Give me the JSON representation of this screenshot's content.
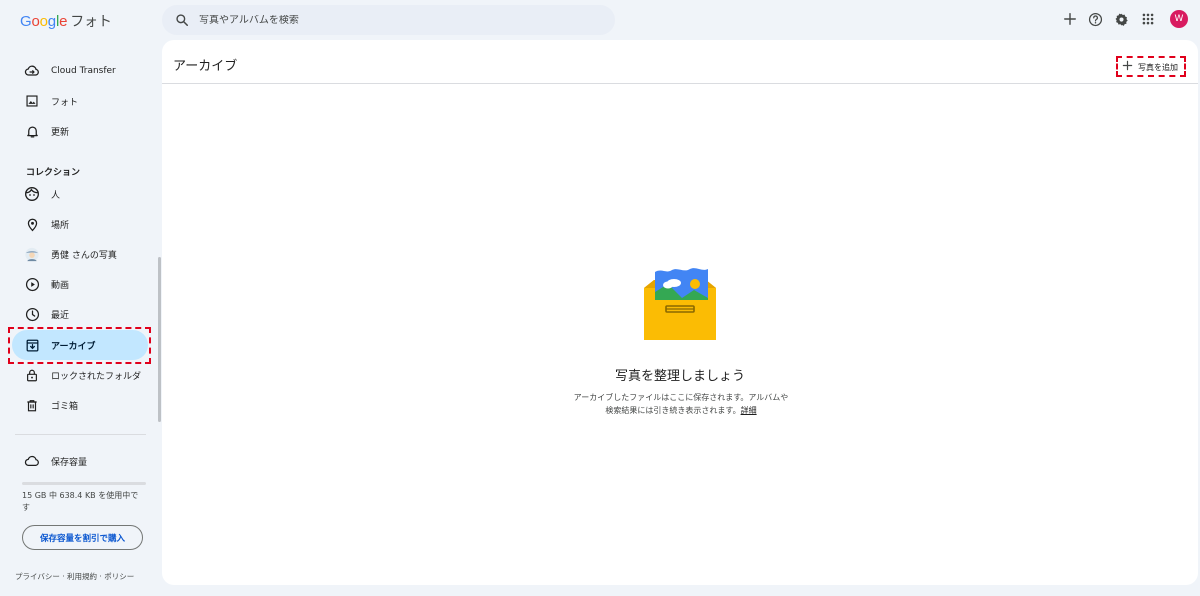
{
  "app": {
    "logo_word": "Google",
    "product": "フォト"
  },
  "search": {
    "placeholder": "写真やアルバムを検索"
  },
  "topbar": {
    "avatar_letter": "W",
    "icons": [
      "plus-icon",
      "help-icon",
      "settings-icon",
      "apps-icon"
    ]
  },
  "sidebar": {
    "items": [
      {
        "label": "Cloud Transfer",
        "icon": "cloud-transfer-icon"
      },
      {
        "label": "フォト",
        "icon": "photo-icon"
      },
      {
        "label": "更新",
        "icon": "bell-icon"
      }
    ],
    "collection_label": "コレクション",
    "collection_items": [
      {
        "label": "人",
        "icon": "face-icon"
      },
      {
        "label": "場所",
        "icon": "location-pin-icon"
      },
      {
        "label": "勇健 さんの写真",
        "icon": "partner-avatar-icon"
      },
      {
        "label": "動画",
        "icon": "play-circle-icon"
      },
      {
        "label": "最近",
        "icon": "clock-icon"
      },
      {
        "label": "アーカイブ",
        "icon": "archive-icon",
        "active": true
      },
      {
        "label": "ロックされたフォルダ",
        "icon": "lock-icon"
      },
      {
        "label": "ゴミ箱",
        "icon": "trash-icon"
      }
    ],
    "storage_label": "保存容量",
    "storage_text": "15 GB 中 638.4 KB を使用中です",
    "storage_used_fraction": 0.0,
    "buy_storage_label": "保存容量を割引で購入",
    "footer": [
      "プライバシー",
      "利用規約",
      "ポリシー"
    ]
  },
  "main": {
    "title": "アーカイブ",
    "add_photos_label": "写真を追加",
    "empty_title": "写真を整理しましょう",
    "empty_desc": "アーカイブしたファイルはここに保存されます。アルバムや検索結果には引き続き表示されます。",
    "learn_more": "詳細"
  },
  "colors": {
    "accent": "#0b57d0",
    "active_bg": "#c2e7ff",
    "highlight_dash": "#e0001b",
    "avatar_bg": "#d81b60"
  }
}
